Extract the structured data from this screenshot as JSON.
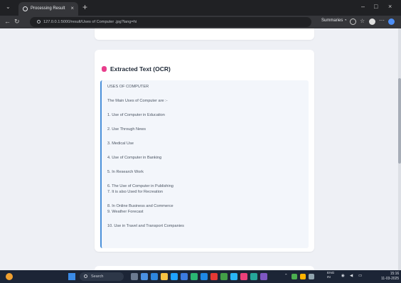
{
  "browser": {
    "tab_title": "Processing Result",
    "tab_close": "×",
    "new_tab": "+",
    "url": "127.0.0.1:5000/result/Uses of Computer .jpg?lang=hi",
    "summaries_label": "Summaries",
    "window_controls": {
      "minimize": "–",
      "maximize": "□",
      "close": "×"
    }
  },
  "card": {
    "title": "Extracted Text (OCR)"
  },
  "ocr_lines": [
    "USES OF COMPUTER",
    "The Main Uses of Computer are :-",
    "1. Use of Computer in Education",
    "2. Use Through News",
    "3. Medical Use",
    "4. Use of Computer in Banking",
    "5. In Research Work",
    "6. The Use of Computer in Publishing",
    "7. It is also Used for Recreation",
    "8. In Online Business and Commerce",
    "9. Weather Forecast",
    "10. Use in Travel and Transport Companies"
  ],
  "taskbar": {
    "search_label": "Search",
    "tray_lang": "ENG",
    "tray_region": "IN",
    "time": "15:16",
    "date": "11-03-2025"
  },
  "colors": {
    "accent": "#4a90d9",
    "heading_icon": "#e83e8c",
    "taskbar_bg": "#1c2536",
    "chrome_bg": "#202124"
  }
}
